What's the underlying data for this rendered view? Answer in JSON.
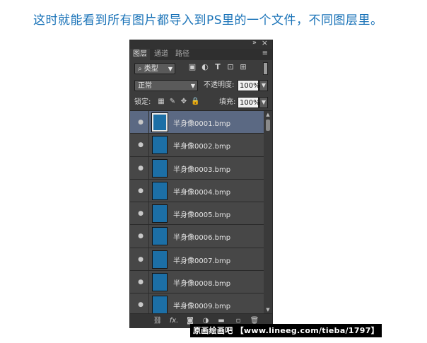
{
  "caption": "这时就能看到所有图片都导入到PS里的一个文件，不同图层里。",
  "panel": {
    "collapse_icon": "double-chevron-icon",
    "close_icon": "close-icon",
    "tabs": [
      {
        "label": "图层",
        "active": true
      },
      {
        "label": "通道",
        "active": false
      },
      {
        "label": "路径",
        "active": false
      }
    ],
    "filter": {
      "kind_label": "类型",
      "icons": [
        "image-filter-icon",
        "adjustment-filter-icon",
        "type-filter-icon",
        "shape-filter-icon",
        "smart-object-filter-icon"
      ]
    },
    "blend_mode": "正常",
    "opacity_label": "不透明度:",
    "opacity_value": "100%",
    "lock_label": "锁定:",
    "fill_label": "填充:",
    "fill_value": "100%",
    "layers": [
      {
        "name": "半身像0001.bmp",
        "selected": true
      },
      {
        "name": "半身像0002.bmp",
        "selected": false
      },
      {
        "name": "半身像0003.bmp",
        "selected": false
      },
      {
        "name": "半身像0004.bmp",
        "selected": false
      },
      {
        "name": "半身像0005.bmp",
        "selected": false
      },
      {
        "name": "半身像0006.bmp",
        "selected": false
      },
      {
        "name": "半身像0007.bmp",
        "selected": false
      },
      {
        "name": "半身像0008.bmp",
        "selected": false
      },
      {
        "name": "半身像0009.bmp",
        "selected": false
      }
    ],
    "bottom_icons": [
      "link-icon",
      "fx-icon",
      "mask-icon",
      "adjustment-icon",
      "folder-icon",
      "new-layer-icon",
      "trash-icon"
    ],
    "fx_label": "fx."
  },
  "watermark": "原画绘画吧 【www.lineeg.com/tieba/1797】",
  "colors": {
    "caption": "#1a73b8",
    "thumbnail": "#1c6fa6",
    "selected": "#5b6983"
  }
}
